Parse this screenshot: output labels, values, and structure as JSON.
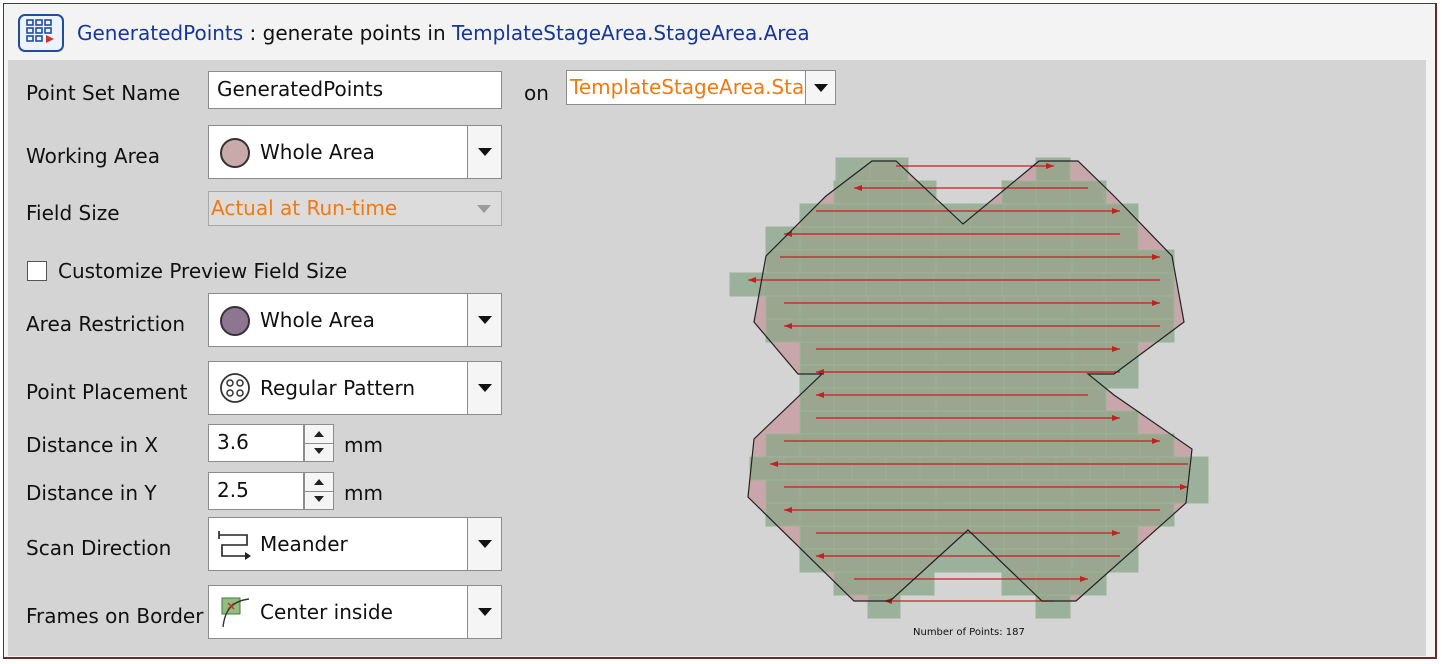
{
  "header": {
    "icon": "point-grid-icon",
    "point_set_link": "GeneratedPoints",
    "middle_text": " : generate points in ",
    "area_link": "TemplateStageArea.StageArea.Area"
  },
  "form": {
    "point_set_name": {
      "label": "Point Set Name",
      "value": "GeneratedPoints"
    },
    "on": {
      "label": "on",
      "value": "TemplateStageArea.Sta"
    },
    "working_area": {
      "label": "Working Area",
      "value": "Whole Area",
      "icon": "circle-fill-icon",
      "icon_color": "#c9a9a9"
    },
    "field_size": {
      "label": "Field Size",
      "value": "Actual at Run-time"
    },
    "customize_preview": {
      "label": "Customize Preview Field Size",
      "checked": false
    },
    "area_restriction": {
      "label": "Area Restriction",
      "value": "Whole Area",
      "icon": "circle-fill-icon",
      "icon_color": "#8e7691"
    },
    "point_placement": {
      "label": "Point Placement",
      "value": "Regular Pattern",
      "icon": "regular-pattern-icon"
    },
    "distance_x": {
      "label": "Distance in X",
      "value": "3.6",
      "unit": "mm"
    },
    "distance_y": {
      "label": "Distance in Y",
      "value": "2.5",
      "unit": "mm"
    },
    "scan_direction": {
      "label": "Scan Direction",
      "value": "Meander",
      "icon": "meander-icon"
    },
    "frames_on_border": {
      "label": "Frames on Border",
      "value": "Center inside",
      "icon": "center-inside-icon"
    }
  },
  "preview": {
    "points_caption": "Number of Points: 187",
    "colors": {
      "area_fill": "#c9a6a9",
      "field_fill": "#8aa588",
      "scan_line": "#c32020"
    }
  },
  "colors": {
    "link": "#15379a",
    "orange": "#f07a10",
    "border": "#6b2a2a"
  }
}
